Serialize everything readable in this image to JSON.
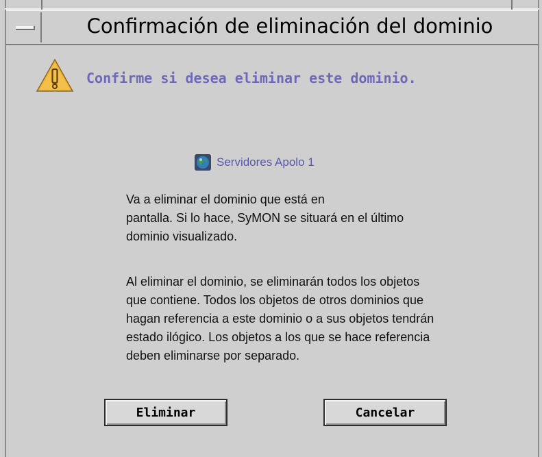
{
  "window": {
    "title": "Confirmación de eliminación del dominio"
  },
  "dialog": {
    "heading": "Confirme si desea eliminar este dominio.",
    "domain_name": "Servidores Apolo 1",
    "paragraph_1": [
      "Va a eliminar el dominio que está en",
      "pantalla. Si lo hace, SyMON se situará en el último",
      "dominio visualizado."
    ],
    "paragraph_2": [
      "Al eliminar el dominio, se eliminarán todos los objetos",
      "que contiene. Todos los objetos de otros dominios que",
      "hagan referencia a este dominio o a sus objetos tendrán",
      "estado ilógico. Los objetos a los que se hace referencia",
      "deben eliminarse por separado."
    ]
  },
  "buttons": {
    "delete_label": "Eliminar",
    "cancel_label": "Cancelar"
  },
  "icons": {
    "window_menu": "window-menu-icon",
    "warning": "warning-icon",
    "domain": "globe-icon"
  },
  "colors": {
    "heading": "#6e68b8",
    "domain_name": "#5b56b0",
    "warning_fill": "#f0b43a"
  }
}
